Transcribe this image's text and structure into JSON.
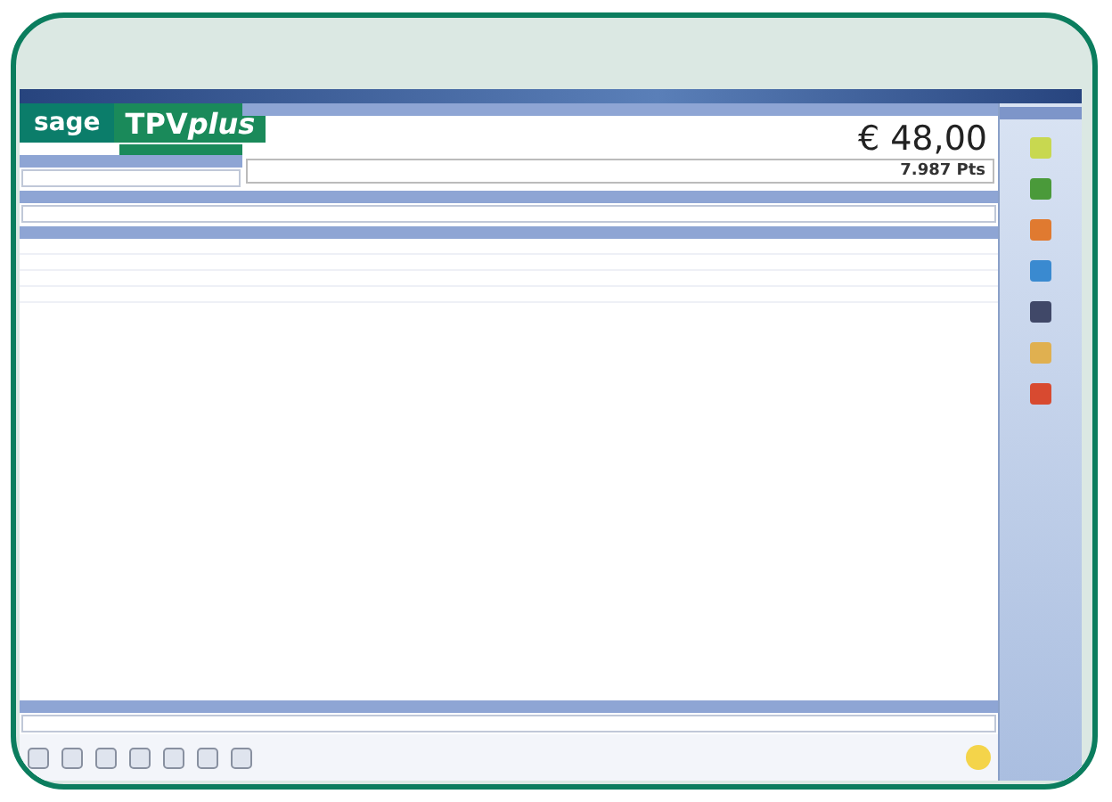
{
  "logo": {
    "brand": "sage",
    "product": "TPV",
    "product_suffix": "plus"
  },
  "total": {
    "amount": "€ 48,00",
    "pesetas": "7.987 Pts"
  }
}
